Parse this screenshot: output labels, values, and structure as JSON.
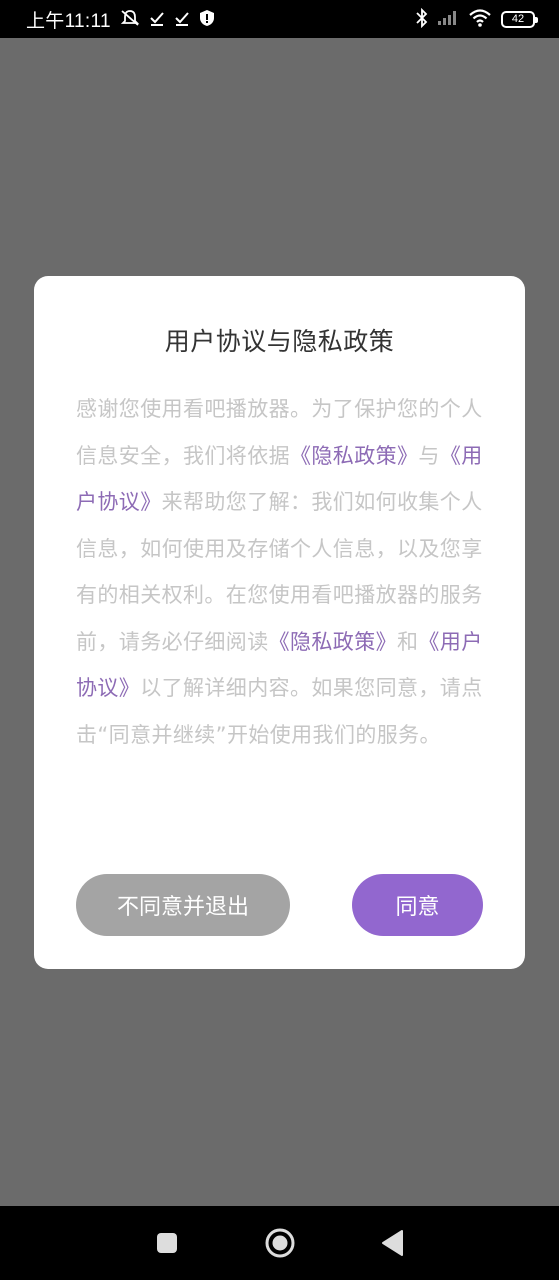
{
  "status_bar": {
    "time": "上午11:11",
    "battery": "42",
    "icons": [
      "mute-icon",
      "check-icon",
      "check-icon",
      "shield-icon",
      "bluetooth-icon",
      "signal-icon",
      "wifi-icon",
      "battery-icon"
    ]
  },
  "dialog": {
    "title": "用户协议与隐私政策",
    "body": [
      {
        "text": "感谢您使用看吧播放器。为了保护您的个人信息安全，我们将依据",
        "link": false
      },
      {
        "text": "《隐私政策》",
        "link": true
      },
      {
        "text": "与",
        "link": false
      },
      {
        "text": "《用户协议》",
        "link": true
      },
      {
        "text": "来帮助您了解：我们如何收集个人信息，如何使用及存储个人信息，以及您享有的相关权利。在您使用看吧播放器的服务前，请务必仔细阅读",
        "link": false
      },
      {
        "text": "《隐私政策》",
        "link": true
      },
      {
        "text": "和",
        "link": false
      },
      {
        "text": "《用户协议》",
        "link": true
      },
      {
        "text": "以了解详细内容。如果您同意，请点击“同意并继续”开始使用我们的服务。",
        "link": false
      }
    ],
    "decline_label": "不同意并退出",
    "agree_label": "同意"
  },
  "colors": {
    "link": "#8d6bb5",
    "agree_button": "#9267cf",
    "decline_button": "#a4a4a4",
    "backdrop": "#6b6b6b"
  }
}
